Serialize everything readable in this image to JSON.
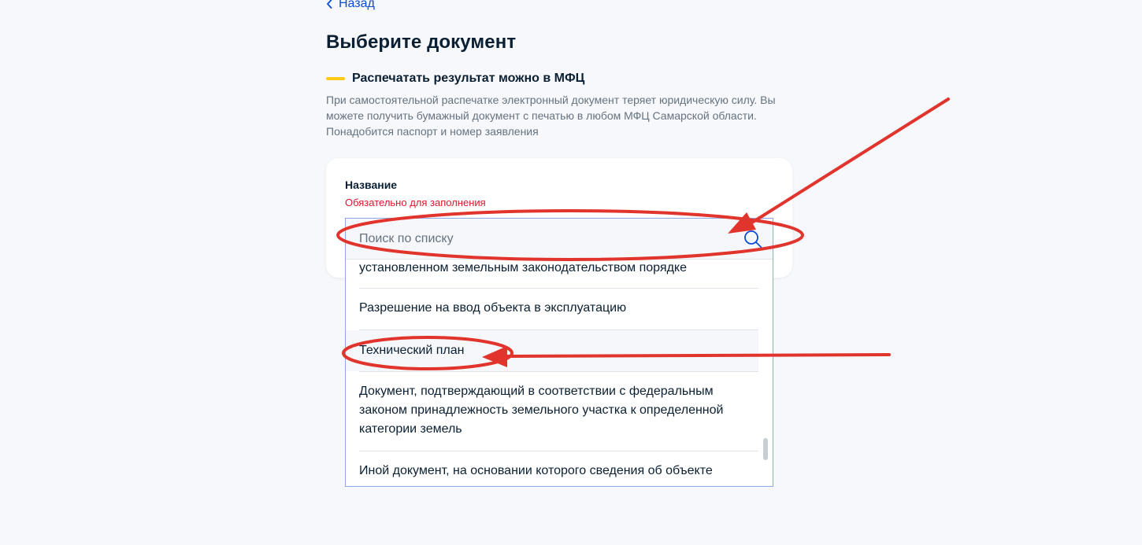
{
  "nav": {
    "back_label": "Назад"
  },
  "page": {
    "title": "Выберите документ"
  },
  "notice": {
    "title": "Распечатать результат можно в МФЦ",
    "text": "При самостоятельной распечатке электронный документ теряет юридическую силу. Вы можете получить бумажный документ с печатью в любом МФЦ Самарской области. Понадобится паспорт и номер заявления"
  },
  "field": {
    "label": "Название",
    "error": "Обязательно для заполнения",
    "search_placeholder": "Поиск по списку",
    "search_value": ""
  },
  "options": [
    {
      "label": "установленном земельным законодательством порядке"
    },
    {
      "label": "Разрешение на ввод объекта в эксплуатацию"
    },
    {
      "label": "Технический план"
    },
    {
      "label": "Документ, подтверждающий в соответствии с федеральным законом принадлежность земельного участка к определенной категории земель"
    },
    {
      "label": "Иной документ, на основании которого сведения об объекте"
    }
  ],
  "colors": {
    "link": "#0d4cd3",
    "accent_mark": "#fcc917",
    "error": "#e1142b",
    "annotation": "#e0342d"
  },
  "icons": {
    "back": "chevron-left-icon",
    "search": "search-icon"
  }
}
